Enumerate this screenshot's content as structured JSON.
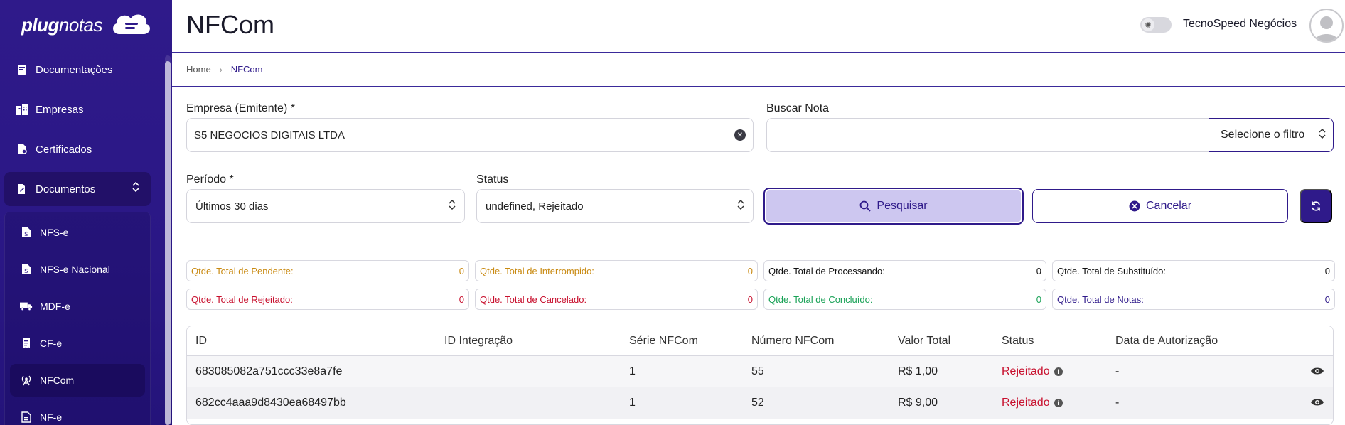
{
  "sidebar": {
    "logo": {
      "bold": "plug",
      "light": "notas"
    },
    "items": [
      {
        "label": "Documentações",
        "icon": "book-icon"
      },
      {
        "label": "Empresas",
        "icon": "buildings-icon"
      },
      {
        "label": "Certificados",
        "icon": "certificate-icon"
      }
    ],
    "group": {
      "label": "Documentos",
      "icon": "document-edit-icon",
      "expanded": true
    },
    "sub_items": [
      {
        "label": "NFS-e",
        "icon": "document-dollar-icon"
      },
      {
        "label": "NFS-e Nacional",
        "icon": "document-dollar-icon"
      },
      {
        "label": "MDF-e",
        "icon": "truck-icon"
      },
      {
        "label": "CF-e",
        "icon": "receipt-icon"
      },
      {
        "label": "NFCom",
        "icon": "antenna-icon",
        "active": true
      },
      {
        "label": "NF-e",
        "icon": "document-icon"
      }
    ]
  },
  "header": {
    "title": "NFCom",
    "company": "TecnoSpeed Negócios"
  },
  "breadcrumb": {
    "home": "Home",
    "current": "NFCom"
  },
  "form": {
    "empresa_label": "Empresa (Emitente) *",
    "empresa_value": "S5 NEGOCIOS DIGITAIS LTDA",
    "buscar_label": "Buscar Nota",
    "buscar_value": "",
    "filter_value": "Selecione o filtro",
    "periodo_label": "Período *",
    "periodo_value": "Últimos 30 dias",
    "status_label": "Status",
    "status_value": "undefined, Rejeitado",
    "search_button": "Pesquisar",
    "cancel_button": "Cancelar"
  },
  "stats": [
    {
      "label": "Qtde. Total de Pendente:",
      "value": "0",
      "color": "#c98a12"
    },
    {
      "label": "Qtde. Total de Interrompido:",
      "value": "0",
      "color": "#c98a12"
    },
    {
      "label": "Qtde. Total de Processando:",
      "value": "0",
      "color": "#111111"
    },
    {
      "label": "Qtde. Total de Substituído:",
      "value": "0",
      "color": "#111111"
    },
    {
      "label": "Qtde. Total de Rejeitado:",
      "value": "0",
      "color": "#c8102e"
    },
    {
      "label": "Qtde. Total de Cancelado:",
      "value": "0",
      "color": "#c8102e"
    },
    {
      "label": "Qtde. Total de Concluído:",
      "value": "0",
      "color": "#1aa257"
    },
    {
      "label": "Qtde. Total de Notas:",
      "value": "0",
      "color": "#2f1a8a"
    }
  ],
  "table": {
    "headers": [
      "ID",
      "ID Integração",
      "Série NFCom",
      "Número NFCom",
      "Valor Total",
      "Status",
      "Data de Autorização"
    ],
    "rows": [
      {
        "id": "683085082a751ccc33e8a7fe",
        "id_integracao": "",
        "serie": "1",
        "numero": "55",
        "valor": "R$ 1,00",
        "status": "Rejeitado",
        "data": "-"
      },
      {
        "id": "682cc4aaa9d8430ea68497bb",
        "id_integracao": "",
        "serie": "1",
        "numero": "52",
        "valor": "R$ 9,00",
        "status": "Rejeitado",
        "data": "-"
      }
    ]
  }
}
